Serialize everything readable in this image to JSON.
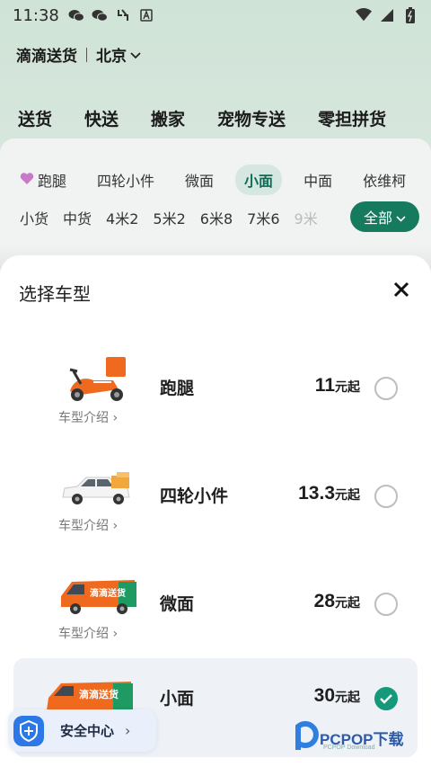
{
  "status_bar": {
    "time": "11:38"
  },
  "header": {
    "app_name": "滴滴送货",
    "city": "北京"
  },
  "service_tabs": [
    "送货",
    "快送",
    "搬家",
    "宠物专送",
    "零担拼货"
  ],
  "vehicle_categories": [
    "跑腿",
    "四轮小件",
    "微面",
    "小面",
    "中面",
    "依维柯"
  ],
  "vehicle_sizes": [
    "小货",
    "中货",
    "4米2",
    "5米2",
    "6米8",
    "7米6",
    "9米"
  ],
  "all_button": "全部",
  "sheet": {
    "title": "选择车型",
    "vehicles": [
      {
        "name": "跑腿",
        "price": "11",
        "unit": "元起",
        "intro": "车型介绍",
        "selected": false
      },
      {
        "name": "四轮小件",
        "price": "13.3",
        "unit": "元起",
        "intro": "车型介绍",
        "selected": false
      },
      {
        "name": "微面",
        "price": "28",
        "unit": "元起",
        "intro": "车型介绍",
        "selected": false
      },
      {
        "name": "小面",
        "price": "30",
        "unit": "元起",
        "intro": "",
        "selected": true
      }
    ]
  },
  "van_brand_text": "滴滴送货",
  "safety": {
    "label": "安全中心"
  },
  "watermark": {
    "brand": "PCPOP下载",
    "sub": "PCPOP Download"
  },
  "colors": {
    "accent": "#13866a",
    "check": "#16997a",
    "orange": "#ef6a1f",
    "shield": "#2b78e6"
  },
  "icons": [
    "wechat-icon",
    "wifi-icon",
    "battery-icon",
    "close-icon",
    "check-icon",
    "shield-icon",
    "chevron-right-icon",
    "chevron-down-icon",
    "heart-icon"
  ]
}
